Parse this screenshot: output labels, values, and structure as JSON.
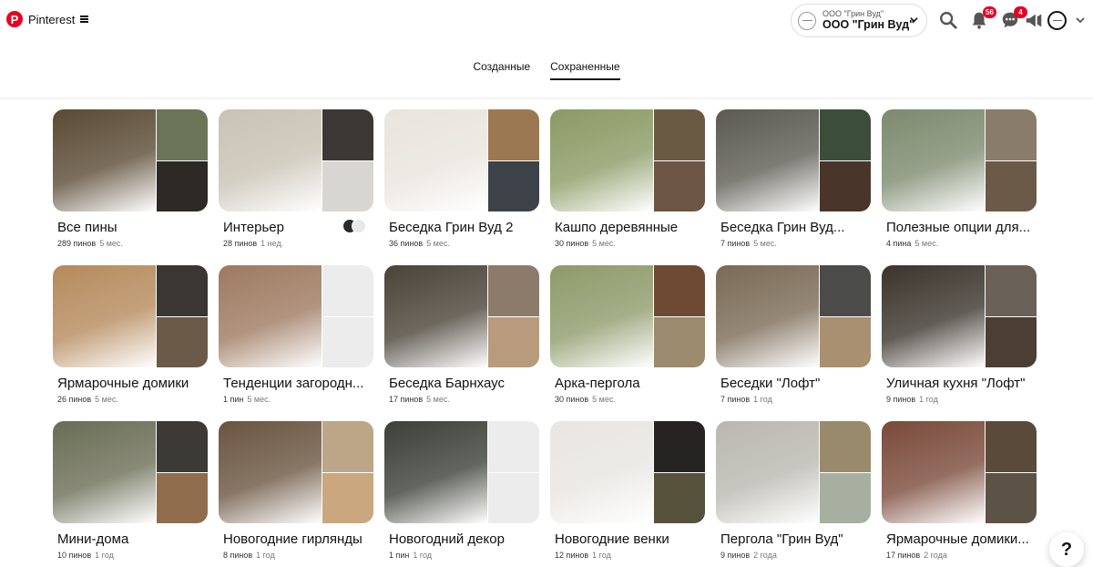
{
  "header": {
    "brand": "Pinterest",
    "account": {
      "small_name": "ООО \"Грин Вуд\"",
      "name": "ООО \"Грин Вуд\""
    },
    "notifications_count": "56",
    "messages_count": "4",
    "icons": [
      "search-icon",
      "bell-icon",
      "chat-icon",
      "megaphone-icon"
    ]
  },
  "tabs": [
    {
      "label": "Созданные",
      "active": false
    },
    {
      "label": "Сохраненные",
      "active": true
    }
  ],
  "boards": [
    {
      "title": "Все пины",
      "count": "289 пинов",
      "age": "5 мес.",
      "colors": [
        "#5a4a34",
        "#6a7457",
        "#2d2a25"
      ]
    },
    {
      "title": "Интерьер",
      "count": "28 пинов",
      "age": "1 нед.",
      "colors": [
        "#c9c2b4",
        "#3b3836",
        "#d8d6d2"
      ]
    },
    {
      "title": "Беседка Грин Вуд 2",
      "count": "36 пинов",
      "age": "5 мес.",
      "colors": [
        "#e9e4dd",
        "#9c7852",
        "#3d4148"
      ]
    },
    {
      "title": "Кашпо деревянные",
      "count": "30 пинов",
      "age": "5 мес.",
      "colors": [
        "#8a9a64",
        "#6b5a43",
        "#6c5542"
      ]
    },
    {
      "title": "Беседка Грин Вуд...",
      "count": "7 пинов",
      "age": "5 мес.",
      "colors": [
        "#5c5b52",
        "#3d4d3b",
        "#4a352a"
      ]
    },
    {
      "title": "Полезные опции для...",
      "count": "4 пина",
      "age": "5 мес.",
      "colors": [
        "#7d8a6e",
        "#8a7c6a",
        "#6c5a48"
      ]
    },
    {
      "title": "Ярмарочные домики",
      "count": "26 пинов",
      "age": "5 мес.",
      "colors": [
        "#b58a5c",
        "#3a3632",
        "#6b5a48"
      ]
    },
    {
      "title": "Тенденции загородн...",
      "count": "1 пин",
      "age": "5 мес.",
      "colors": [
        "#9d7a60",
        "#ececec",
        "#ececec"
      ]
    },
    {
      "title": "Беседка Барнхаус",
      "count": "17 пинов",
      "age": "5 мес.",
      "colors": [
        "#4a4338",
        "#8c7b6a",
        "#b79b7c"
      ]
    },
    {
      "title": "Арка-пергола",
      "count": "30 пинов",
      "age": "5 мес.",
      "colors": [
        "#8e9a6a",
        "#6e4a33",
        "#9c8a6c"
      ]
    },
    {
      "title": "Беседки \"Лофт\"",
      "count": "7 пинов",
      "age": "1 год",
      "colors": [
        "#7a6a55",
        "#4b4b49",
        "#a89070"
      ]
    },
    {
      "title": "Уличная кухня \"Лофт\"",
      "count": "9 пинов",
      "age": "1 год",
      "colors": [
        "#3b342c",
        "#6a6259",
        "#4b3e32"
      ]
    },
    {
      "title": "Мини-дома",
      "count": "10 пинов",
      "age": "1 год",
      "colors": [
        "#6a6d55",
        "#3c3a34",
        "#8f6d4c"
      ]
    },
    {
      "title": "Новогодние гирлянды",
      "count": "8 пинов",
      "age": "1 год",
      "colors": [
        "#6a5540",
        "#bca687",
        "#caa77e"
      ]
    },
    {
      "title": "Новогодний декор",
      "count": "1 пин",
      "age": "1 год",
      "colors": [
        "#3d4038",
        "#ececec",
        "#ececec"
      ]
    },
    {
      "title": "Новогодние венки",
      "count": "12 пинов",
      "age": "1 год",
      "colors": [
        "#e8e6e2",
        "#252423",
        "#55513b"
      ]
    },
    {
      "title": "Пергола \"Грин Вуд\"",
      "count": "9 пинов",
      "age": "2 года",
      "colors": [
        "#b9b8b0",
        "#9a8a6c",
        "#a7b0a0"
      ]
    },
    {
      "title": "Ярмарочные домики...",
      "count": "17 пинов",
      "age": "2 года",
      "colors": [
        "#7a4a3a",
        "#5a4a3a",
        "#5c5246"
      ]
    }
  ],
  "help_label": "?"
}
